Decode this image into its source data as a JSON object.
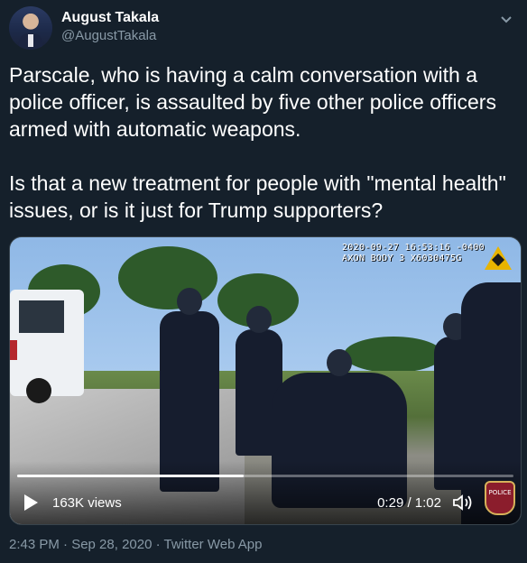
{
  "author": {
    "display_name": "August Takala",
    "handle": "@AugustTakala"
  },
  "tweet": {
    "paragraph_1": "Parscale, who is having a calm conversation with a police officer, is assaulted by five other police officers armed with automatic weapons.",
    "paragraph_2": "Is that a new treatment for people with \"mental health\" issues, or is it just for Trump supporters?"
  },
  "media": {
    "overlay_timestamp_line1": "2020-09-27  16:53:16 -0400",
    "overlay_timestamp_line2": "AXON BODY 3  X6030475G",
    "badge_text": "POLICE",
    "views": "163K views",
    "time": "0:29 / 1:02",
    "progress_fraction": 0.457
  },
  "footer": {
    "meta": "2:43 PM · Sep 28, 2020 · Twitter Web App"
  },
  "colors": {
    "background": "#15202b",
    "secondary_text": "#8899a6",
    "border": "#38444d"
  }
}
